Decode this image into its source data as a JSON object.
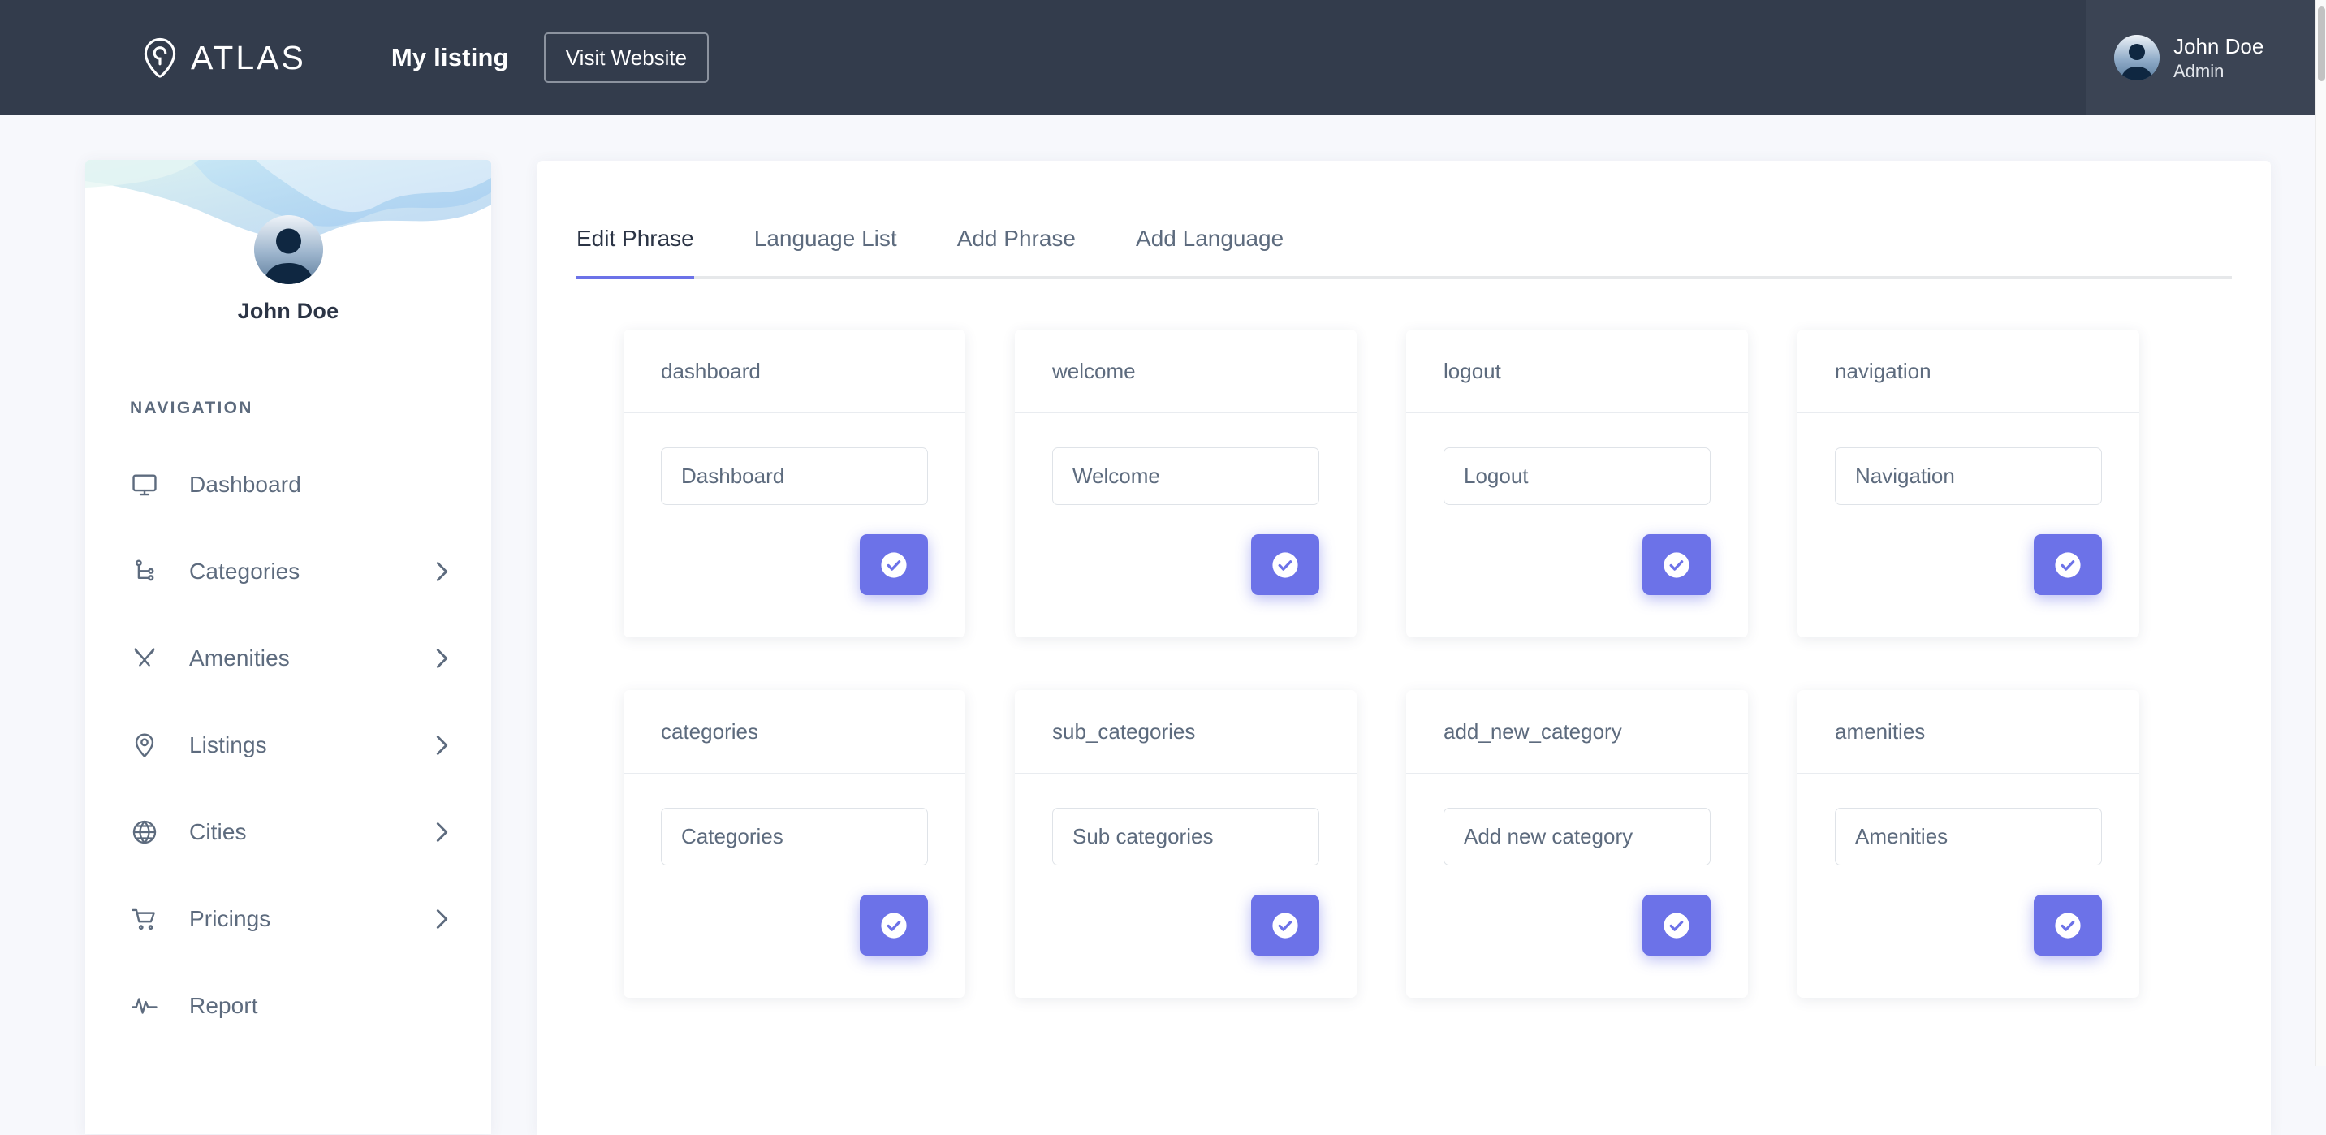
{
  "topbar": {
    "brand_name": "ATLAS",
    "brand_icon": "map-pin-icon",
    "my_listing_label": "My listing",
    "visit_website_label": "Visit Website",
    "user": {
      "name": "John Doe",
      "role": "Admin",
      "avatar_icon": "user-avatar"
    }
  },
  "sidebar": {
    "profile": {
      "name": "John Doe",
      "avatar_icon": "user-avatar"
    },
    "nav_heading": "NAVIGATION",
    "items": [
      {
        "label": "Dashboard",
        "icon": "monitor-icon",
        "has_chevron": false
      },
      {
        "label": "Categories",
        "icon": "git-branch-icon",
        "has_chevron": true
      },
      {
        "label": "Amenities",
        "icon": "fork-knife-icon",
        "has_chevron": true
      },
      {
        "label": "Listings",
        "icon": "map-pin-icon",
        "has_chevron": true
      },
      {
        "label": "Cities",
        "icon": "globe-icon",
        "has_chevron": true
      },
      {
        "label": "Pricings",
        "icon": "shopping-cart-icon",
        "has_chevron": true
      },
      {
        "label": "Report",
        "icon": "activity-pulse-icon",
        "has_chevron": false
      }
    ]
  },
  "main": {
    "tabs": [
      {
        "label": "Edit Phrase",
        "active": true
      },
      {
        "label": "Language List",
        "active": false
      },
      {
        "label": "Add Phrase",
        "active": false
      },
      {
        "label": "Add Language",
        "active": false
      }
    ],
    "save_icon": "check-circle-icon",
    "phrases": [
      {
        "key": "dashboard",
        "value": "Dashboard"
      },
      {
        "key": "welcome",
        "value": "Welcome"
      },
      {
        "key": "logout",
        "value": "Logout"
      },
      {
        "key": "navigation",
        "value": "Navigation"
      },
      {
        "key": "categories",
        "value": "Categories"
      },
      {
        "key": "sub_categories",
        "value": "Sub categories"
      },
      {
        "key": "add_new_category",
        "value": "Add new category"
      },
      {
        "key": "amenities",
        "value": "Amenities"
      }
    ]
  },
  "colors": {
    "topbar_bg": "#333c4c",
    "accent": "#6c72e8",
    "page_bg": "#f7f8fc",
    "text_muted": "#5d6b7e"
  }
}
